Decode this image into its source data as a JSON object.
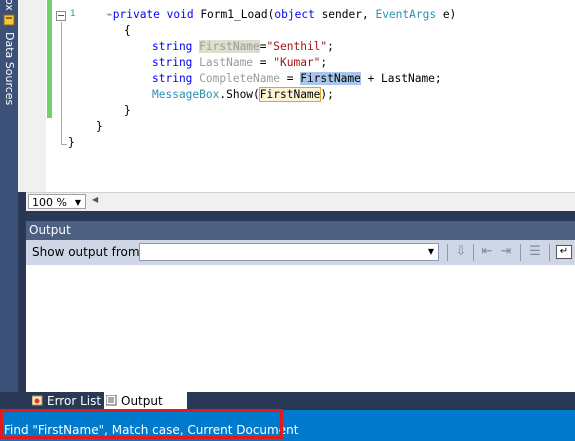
{
  "left_strip": {
    "tab_partial": "ox",
    "data_sources_label": "Data Sources",
    "icon": "database-icon"
  },
  "editor": {
    "line_number": "1",
    "lines": {
      "sig_a": "private void ",
      "sig_b": "Form1_Load(",
      "sig_c": "object",
      "sig_d": " sender, ",
      "sig_e": "EventArgs",
      "sig_f": " e)",
      "open_brace": "{",
      "l1_type": "string ",
      "l1_var": "FirstName",
      "l1_rest": "=",
      "l1_str": "\"Senthil\"",
      "l1_end": ";",
      "l2_type": "string ",
      "l2_var": "LastName",
      "l2_rest": " = ",
      "l2_str": "\"Kumar\"",
      "l2_end": ";",
      "l3_type": "string ",
      "l3_var": "CompleteName",
      "l3_eq": " = ",
      "l3_sel": "FirstName",
      "l3_rest": " + LastName;",
      "l4_cls": "MessageBox",
      "l4_mid": ".Show(",
      "l4_arg": "FirstName",
      "l4_end": ");",
      "close_method": "}",
      "close_class": "}",
      "close_ns": "}"
    }
  },
  "zoom": {
    "value": "100 %"
  },
  "output": {
    "title": "Output",
    "show_from_label": "Show output from:",
    "source_value": ""
  },
  "bottom_tabs": {
    "error_list": "Error List",
    "output": "Output"
  },
  "status": {
    "text": "Find \"FirstName\", Match case, Current Document"
  },
  "colors": {
    "status_bar": "#007acc",
    "highlight_box": "#e3191c",
    "keyword": "#0000ff",
    "type": "#2b91af",
    "string": "#a31515"
  }
}
